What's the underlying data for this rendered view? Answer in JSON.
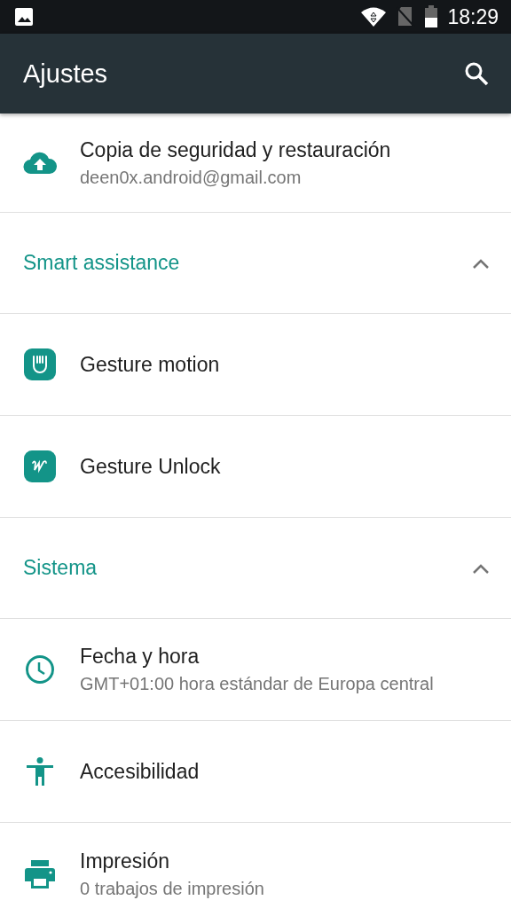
{
  "status_bar": {
    "time": "18:29"
  },
  "app_bar": {
    "title": "Ajustes"
  },
  "list": [
    {
      "kind": "item",
      "title": "Copia de seguridad y restauración",
      "subtitle": "deen0x.android@gmail.com"
    },
    {
      "kind": "header",
      "title": "Smart assistance",
      "expanded": true
    },
    {
      "kind": "item",
      "title": "Gesture motion"
    },
    {
      "kind": "item",
      "title": "Gesture Unlock"
    },
    {
      "kind": "header",
      "title": "Sistema",
      "expanded": true
    },
    {
      "kind": "item",
      "title": "Fecha y hora",
      "subtitle": "GMT+01:00 hora estándar de Europa central"
    },
    {
      "kind": "item",
      "title": "Accesibilidad"
    },
    {
      "kind": "item",
      "title": "Impresión",
      "subtitle": "0 trabajos de impresión"
    }
  ]
}
